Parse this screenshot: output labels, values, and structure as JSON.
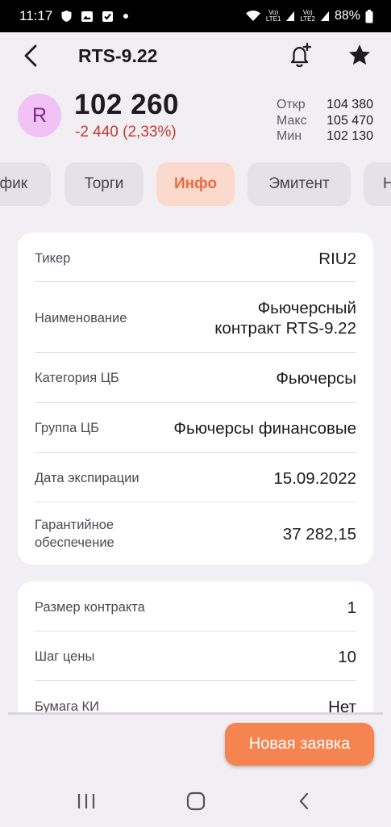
{
  "status_bar": {
    "time": "11:17",
    "battery": "88%",
    "sim1_label": "Vo) LTE1",
    "sim2_label": "Vo) LTE2",
    "sim1_top": "Vo)",
    "sim1_bottom": "LTE1",
    "sim2_top": "Vo)",
    "sim2_bottom": "LTE2",
    "icons": [
      "shield-icon",
      "photo-icon",
      "check-icon",
      "dot-icon",
      "wifi-icon",
      "signal-icon",
      "battery-icon"
    ]
  },
  "header": {
    "title": "RTS-9.22",
    "icons": [
      "back-icon",
      "bell-plus-icon",
      "star-icon"
    ]
  },
  "instrument": {
    "avatar_letter": "R",
    "price": "102 260",
    "change": "-2 440 (2,33%)",
    "stats": [
      {
        "label": "Откр",
        "value": "104 380"
      },
      {
        "label": "Макс",
        "value": "105 470"
      },
      {
        "label": "Мин",
        "value": "102 130"
      }
    ]
  },
  "colors": {
    "accent": "#f58451",
    "accent_text": "#e96d3f",
    "tab_active_bg": "#fcd9cd",
    "negative": "#c6392c",
    "avatar_bg": "#f2c2f7",
    "avatar_fg": "#7b2a86"
  },
  "tabs": [
    {
      "label": "афик",
      "active": false
    },
    {
      "label": "Торги",
      "active": false
    },
    {
      "label": "Инфо",
      "active": true
    },
    {
      "label": "Эмитент",
      "active": false
    },
    {
      "label": "Н",
      "active": false
    }
  ],
  "info_card": {
    "rows": [
      {
        "label": "Тикер",
        "value": "RIU2"
      },
      {
        "label": "Наименование",
        "value_line1": "Фьючерсный",
        "value_line2": "контракт RTS-9.22"
      },
      {
        "label": "Категория ЦБ",
        "value": "Фьючерсы"
      },
      {
        "label": "Группа ЦБ",
        "value": "Фьючерсы финансовые"
      },
      {
        "label": "Дата экспирации",
        "value": "15.09.2022"
      },
      {
        "label_line1": "Гарантийное",
        "label_line2": "обеспечение",
        "value": "37 282,15"
      }
    ]
  },
  "contract_card": {
    "rows": [
      {
        "label": "Размер контракта",
        "value": "1"
      },
      {
        "label": "Шаг цены",
        "value": "10"
      },
      {
        "label": "Бумага КИ",
        "value": "Нет"
      }
    ]
  },
  "fab": {
    "label": "Новая заявка"
  },
  "nav_bar": {
    "icons": [
      "recents-icon",
      "home-icon",
      "back-nav-icon"
    ]
  }
}
